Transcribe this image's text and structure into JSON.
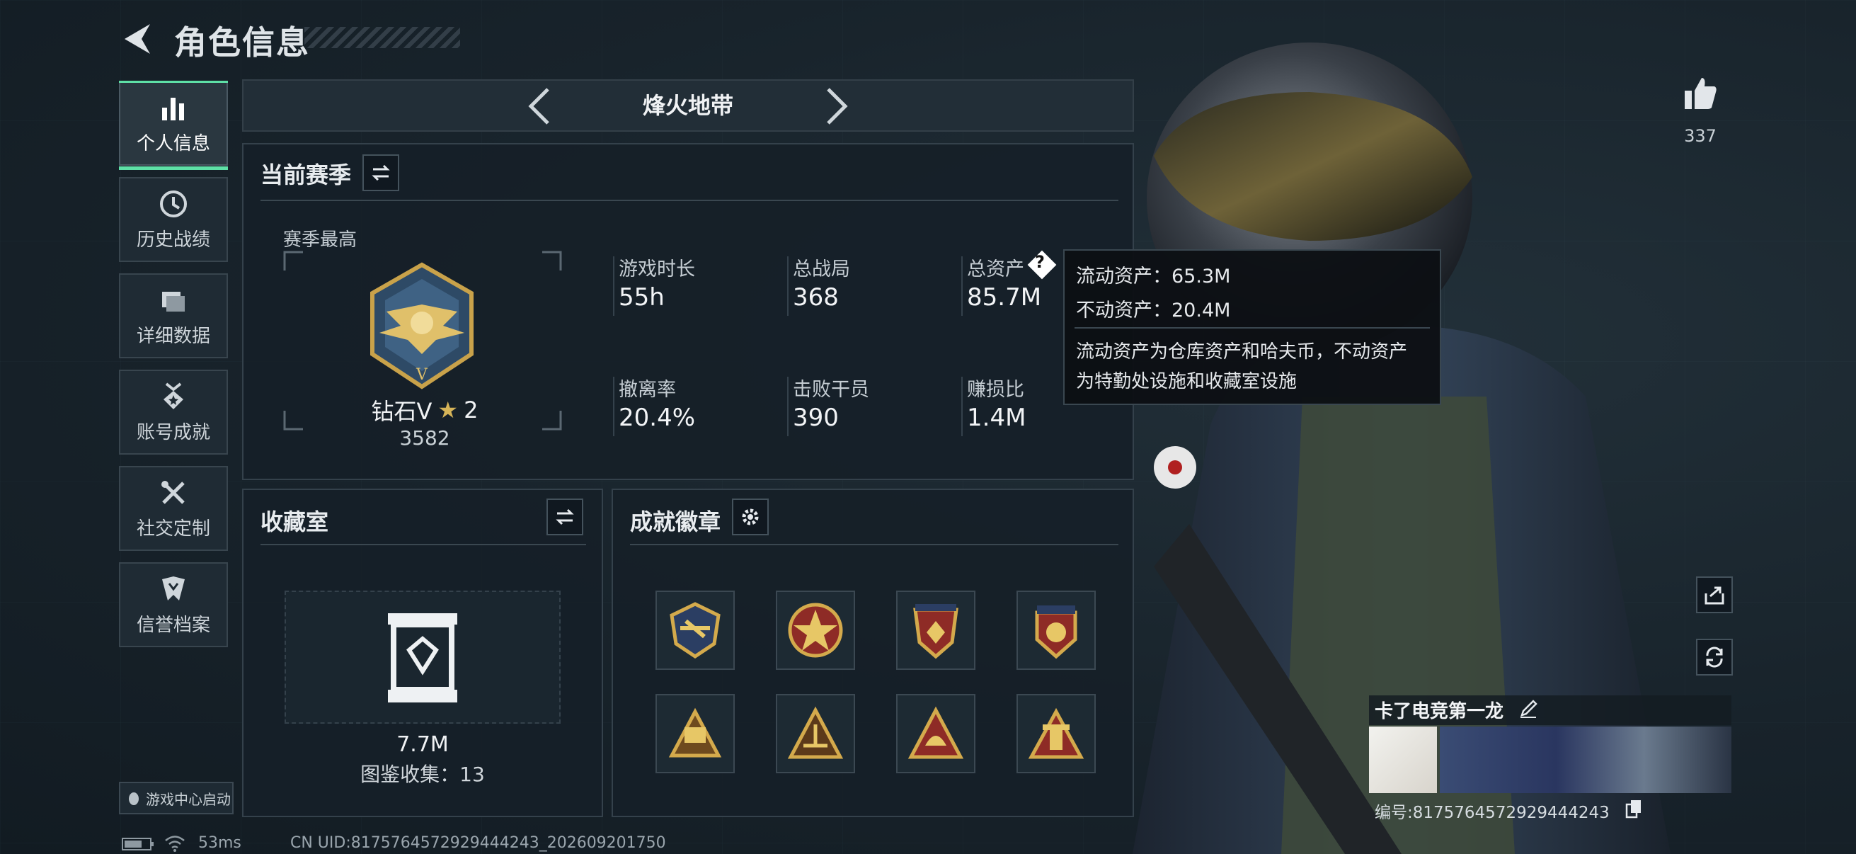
{
  "header": {
    "title": "角色信息"
  },
  "sidebar": {
    "items": [
      {
        "label": "个人信息",
        "active": true
      },
      {
        "label": "历史战绩"
      },
      {
        "label": "详细数据"
      },
      {
        "label": "账号成就"
      },
      {
        "label": "社交定制"
      },
      {
        "label": "信誉档案"
      }
    ],
    "launch_label": "游戏中心启动"
  },
  "mode_tab": {
    "title": "烽火地带"
  },
  "season": {
    "title": "当前赛季",
    "best_label": "赛季最高",
    "rank": "钻石V",
    "stars": "2",
    "score": "3582",
    "stats": [
      {
        "label": "游戏时长",
        "value": "55h"
      },
      {
        "label": "总战局",
        "value": "368"
      },
      {
        "label": "总资产",
        "value": "85.7M"
      },
      {
        "label": "撤离率",
        "value": "20.4%"
      },
      {
        "label": "击败干员",
        "value": "390"
      },
      {
        "label": "赚损比",
        "value": "1.4M"
      }
    ]
  },
  "tooltip": {
    "liquid": "流动资产：65.3M",
    "fixed": "不动资产：20.4M",
    "desc_line1": "流动资产为仓库资产和哈夫币，不动资产",
    "desc_line2": "为特勤处设施和收藏室设施"
  },
  "collection": {
    "title": "收藏室",
    "value": "7.7M",
    "count_text": "图鉴收集：13"
  },
  "badges": {
    "title": "成就徽章",
    "items": [
      "badge-1",
      "badge-2",
      "badge-3",
      "badge-4",
      "badge-5",
      "badge-6",
      "badge-7",
      "badge-8"
    ]
  },
  "likes": {
    "count": "337"
  },
  "profile": {
    "name": "卡了电竞第一龙",
    "uid_text": "编号:8175764572929444243"
  },
  "status": {
    "ping": "53ms",
    "cn_uid": "CN UID:8175764572929444243_202609201750"
  },
  "colors": {
    "accent": "#5ee0a6",
    "gold": "#c9a24a",
    "panel": "#16202a"
  }
}
